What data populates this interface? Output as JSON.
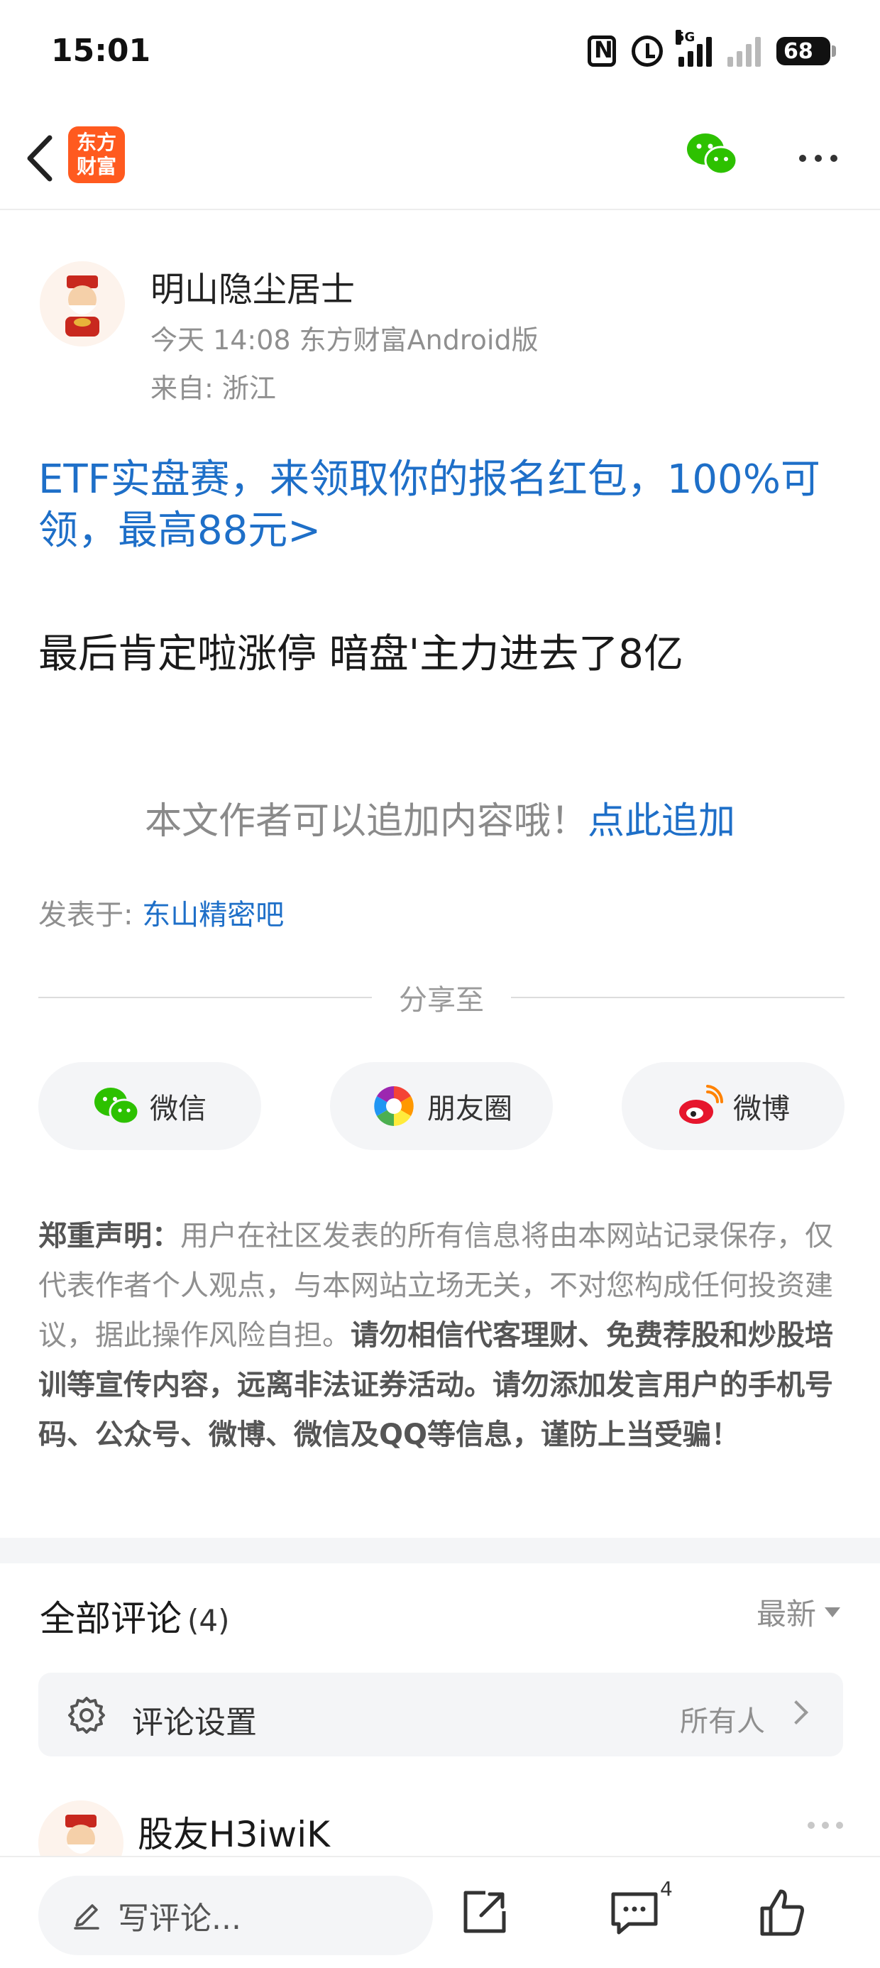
{
  "status_bar": {
    "time": "15:01",
    "network": "5G",
    "battery": "68"
  },
  "nav": {
    "app_logo_line1": "东方",
    "app_logo_line2": "财富"
  },
  "author": {
    "name": "明山隐尘居士",
    "meta": "今天 14:08 东方财富Android版",
    "location": "来自: 浙江"
  },
  "promo": {
    "text": "ETF实盘赛，来领取你的报名红包，100%可领，最高88元>"
  },
  "post": {
    "body": "最后肯定啦涨停 暗盘'主力进去了8亿"
  },
  "append": {
    "hint": "本文作者可以追加内容哦！",
    "link": "点此追加"
  },
  "posted_in": {
    "label": "发表于: ",
    "bar": "东山精密吧"
  },
  "share": {
    "title": "分享至",
    "wechat": "微信",
    "moments": "朋友圈",
    "weibo": "微博"
  },
  "disclaimer": {
    "heading": "郑重声明：",
    "normal": "用户在社区发表的所有信息将由本网站记录保存，仅代表作者个人观点，与本网站立场无关，不对您构成任何投资建议，据此操作风险自担。",
    "bold": "请勿相信代客理财、免费荐股和炒股培训等宣传内容，远离非法证券活动。请勿添加发言用户的手机号码、公众号、微博、微信及QQ等信息，谨防上当受骗！"
  },
  "comments": {
    "title": "全部评论",
    "count": "(4)",
    "sort": "最新",
    "settings_label": "评论设置",
    "settings_value": "所有人",
    "first_user": "股友H3iwiK"
  },
  "bottom_bar": {
    "placeholder": "写评论...",
    "comment_badge": "4"
  },
  "colors": {
    "brand": "#ff5a1f",
    "link": "#1e6fc8",
    "wechat": "#2dc100"
  }
}
